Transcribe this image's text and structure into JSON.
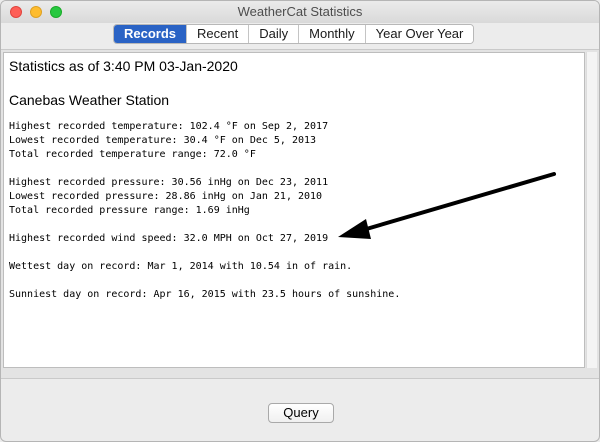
{
  "window": {
    "title": "WeatherCat Statistics"
  },
  "tabs": [
    {
      "label": "Records",
      "active": true
    },
    {
      "label": "Recent",
      "active": false
    },
    {
      "label": "Daily",
      "active": false
    },
    {
      "label": "Monthly",
      "active": false
    },
    {
      "label": "Year Over Year",
      "active": false
    }
  ],
  "report": {
    "as_of": "Statistics as of 3:40 PM 03-Jan-2020",
    "station": "Canebas Weather Station",
    "temperature": [
      "Highest recorded temperature: 102.4 °F on Sep 2, 2017",
      "Lowest recorded temperature: 30.4 °F on Dec 5, 2013",
      "Total recorded temperature range: 72.0 °F"
    ],
    "pressure": [
      "Highest recorded pressure: 30.56 inHg on Dec 23, 2011",
      "Lowest recorded pressure: 28.86 inHg on Jan 21, 2010",
      "Total recorded pressure range: 1.69 inHg"
    ],
    "wind": "Highest recorded wind speed: 32.0 MPH on Oct 27, 2019",
    "rain": "Wettest day on record: Mar 1, 2014 with 10.54 in of rain.",
    "sun": "Sunniest day on record: Apr 16, 2015 with 23.5 hours of sunshine."
  },
  "footer": {
    "query_label": "Query"
  },
  "colors": {
    "active_tab": "#2a63c5",
    "close": "#fe5f57",
    "minimize": "#febc2e",
    "maximize": "#28c840"
  }
}
